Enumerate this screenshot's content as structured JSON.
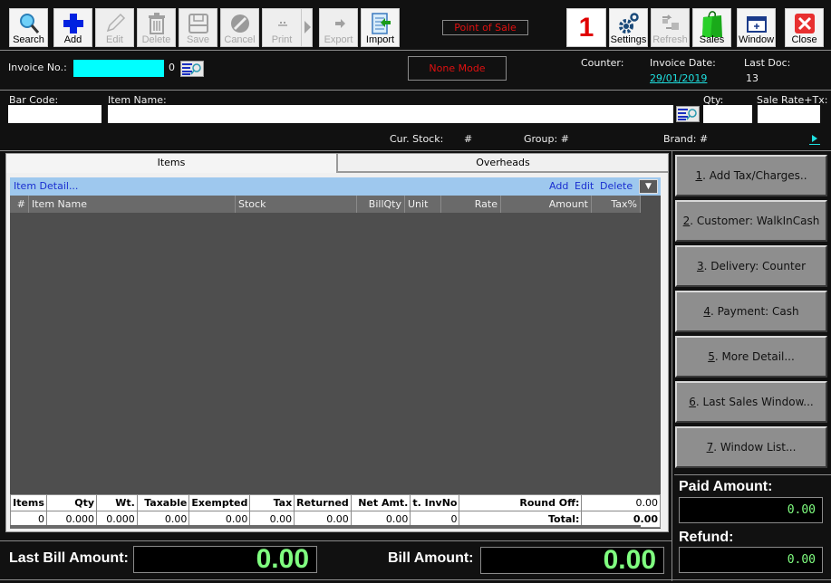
{
  "toolbar": {
    "buttons": [
      {
        "label": "Search",
        "icon": "search-icon",
        "enabled": true
      },
      {
        "label": "Add",
        "icon": "plus-icon",
        "enabled": true
      },
      {
        "label": "Edit",
        "icon": "pencil-icon",
        "enabled": false
      },
      {
        "label": "Delete",
        "icon": "trash-icon",
        "enabled": false
      },
      {
        "label": "Save",
        "icon": "floppy-icon",
        "enabled": false
      },
      {
        "label": "Cancel",
        "icon": "cancel-icon",
        "enabled": false
      },
      {
        "label": "Print",
        "icon": "printer-icon",
        "enabled": false
      },
      {
        "label": "Export",
        "icon": "export-arrow-icon",
        "enabled": false
      },
      {
        "label": "Import",
        "icon": "import-document-icon",
        "enabled": true
      }
    ],
    "title": "Point of Sale",
    "counter_number": "1",
    "right_buttons": [
      {
        "label": "Settings",
        "icon": "gears-icon",
        "enabled": true
      },
      {
        "label": "Refresh",
        "icon": "refresh-icon",
        "enabled": false
      },
      {
        "label": "Sales",
        "icon": "shopping-bag-icon",
        "enabled": true
      },
      {
        "label": "Window",
        "icon": "window-icon",
        "enabled": true
      },
      {
        "label": "Close",
        "icon": "close-icon",
        "enabled": true
      }
    ]
  },
  "invoice": {
    "invoice_no_label": "Invoice No.:",
    "invoice_no_value": "",
    "invoice_suffix": "0",
    "mode": "None Mode",
    "counter_label": "Counter:",
    "counter_value": "",
    "invoice_date_label": "Invoice Date:",
    "invoice_date": "29/01/2019",
    "last_doc_label": "Last Doc:",
    "last_doc_value": "13"
  },
  "entry": {
    "barcode_label": "Bar Code:",
    "barcode_value": "",
    "item_name_label": "Item Name:",
    "item_name_value": "",
    "qty_label": "Qty:",
    "qty_value": "",
    "sale_rate_label": "Sale Rate+Tx:",
    "sale_rate_value": "",
    "cur_stock_label": "Cur. Stock:",
    "cur_stock_value": "#",
    "group_label": "Group: #",
    "brand_label": "Brand: #"
  },
  "tabs": [
    {
      "label": "Items",
      "active": true
    },
    {
      "label": "Overheads",
      "active": false
    }
  ],
  "detail_bar": {
    "title": "Item Detail...",
    "add": "Add",
    "edit": "Edit",
    "delete": "Delete",
    "dropdown": "▼"
  },
  "grid": {
    "columns": [
      "#",
      "Item Name",
      "Stock",
      "BillQty",
      "Unit",
      "Rate",
      "Amount",
      "Tax%"
    ],
    "rows": []
  },
  "summary": {
    "headers": [
      "Items",
      "Qty",
      "Wt.",
      "Taxable",
      "Exempted",
      "Tax",
      "Returned",
      "Net Amt.",
      "t. InvNo",
      "Round Off:",
      "0.00"
    ],
    "values": [
      "0",
      "0.000",
      "0.000",
      "0.00",
      "0.00",
      "0.00",
      "0.00",
      "0.00",
      "0",
      "Total:",
      "0.00"
    ]
  },
  "side_buttons": [
    {
      "num": "1",
      "text": ". Add Tax/Charges.."
    },
    {
      "num": "2",
      "text": ". Customer: WalkInCash"
    },
    {
      "num": "3",
      "text": ". Delivery: Counter"
    },
    {
      "num": "4",
      "text": ". Payment: Cash"
    },
    {
      "num": "5",
      "text": ". More Detail..."
    },
    {
      "num": "6",
      "text": ". Last Sales Window..."
    },
    {
      "num": "7",
      "text": ". Window List..."
    }
  ],
  "payment": {
    "paid_label": "Paid Amount:",
    "paid_value": "0.00",
    "refund_label": "Refund:",
    "refund_value": "0.00"
  },
  "footer": {
    "last_bill_label": "Last Bill Amount:",
    "last_bill_value": "0.00",
    "bill_label": "Bill Amount:",
    "bill_value": "0.00"
  },
  "colors": {
    "accent_cyan": "#00ffff",
    "alert_red": "#e01010",
    "money_green": "#80ff80",
    "detail_bar_blue": "#9ec8ee"
  }
}
